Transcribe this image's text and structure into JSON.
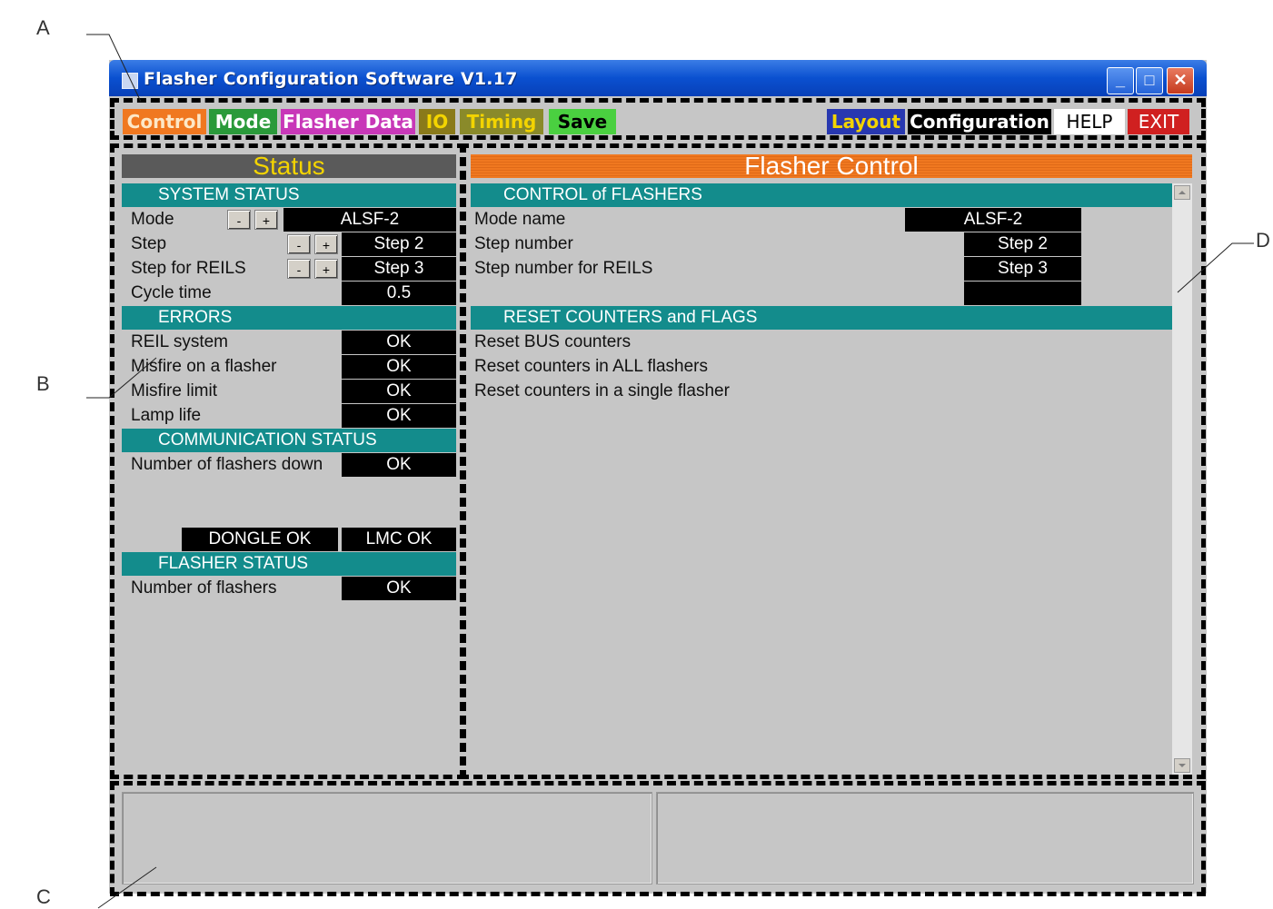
{
  "callouts": {
    "a": "A",
    "b": "B",
    "c": "C",
    "d": "D"
  },
  "window": {
    "title": "Flasher Configuration Software V1.17",
    "buttons": {
      "minimize": "_",
      "maximize": "□",
      "close": "✕"
    }
  },
  "toolbar": {
    "control": "Control",
    "mode": "Mode",
    "flasher_data": "Flasher Data",
    "io": "IO",
    "timing": "Timing",
    "save": "Save",
    "layout": "Layout",
    "configuration": "Configuration",
    "help": "HELP",
    "exit": "EXIT"
  },
  "status_panel": {
    "title": "Status",
    "system_status": {
      "heading": "SYSTEM STATUS",
      "mode_label": "Mode",
      "mode_value": "ALSF-2",
      "step_label": "Step",
      "step_value": "Step 2",
      "step_reils_label": "Step for REILS",
      "step_reils_value": "Step 3",
      "cycle_label": "Cycle time",
      "cycle_value": "0.5",
      "minus": "-",
      "plus": "+"
    },
    "errors": {
      "heading": "ERRORS",
      "reil_label": "REIL system",
      "reil_value": "OK",
      "misfire_label": "Misfire on a flasher",
      "misfire_value": "OK",
      "misfire_limit_label": "Misfire limit",
      "misfire_limit_value": "OK",
      "lamp_label": "Lamp life",
      "lamp_value": "OK"
    },
    "communication": {
      "heading": "COMMUNICATION STATUS",
      "down_label": "Number of flashers down",
      "down_value": "OK",
      "dongle": "DONGLE OK",
      "lmc": "LMC OK"
    },
    "flasher_status": {
      "heading": "FLASHER STATUS",
      "count_label": "Number of flashers",
      "count_value": "OK"
    }
  },
  "control_panel": {
    "title": "Flasher Control",
    "control": {
      "heading": "CONTROL of FLASHERS",
      "mode_name_label": "Mode name",
      "mode_name_value": "ALSF-2",
      "step_number_label": "Step number",
      "step_number_value": "Step 2",
      "step_reils_label": "Step number for REILS",
      "step_reils_value": "Step 3"
    },
    "reset": {
      "heading": "RESET COUNTERS and FLAGS",
      "bus": "Reset BUS counters",
      "all": "Reset counters in ALL flashers",
      "single": "Reset counters in a single flasher"
    }
  },
  "colors": {
    "control_btn": "#f07820",
    "mode_btn": "#2a9a3a",
    "flasher_data_btn": "#c838b8",
    "io_btn": "#8a7a1a",
    "timing_btn": "#8a8a2a",
    "save_btn": "#4ad040",
    "layout_btn": "#2838b0",
    "configuration_btn": "#000000",
    "help_btn": "#ffffff",
    "exit_btn": "#d02020",
    "section_teal": "#138c8c",
    "header_yellow": "#f3d400"
  }
}
